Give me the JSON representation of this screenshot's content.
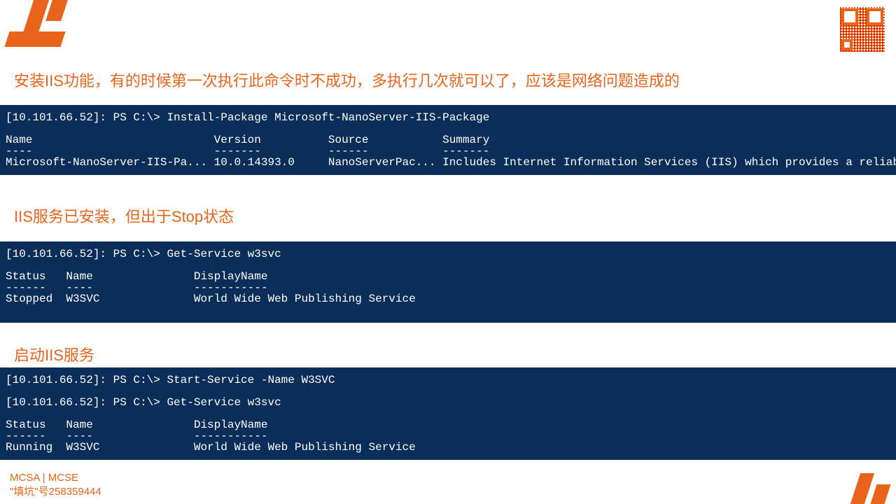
{
  "headings": {
    "h1": "安装IIS功能，有的时候第一次执行此命令时不成功，多执行几次就可以了，应该是网络问题造成的",
    "h2": "IIS服务已安装，但出于Stop状态",
    "h3": "启动IIS服务"
  },
  "terminal1": "[10.101.66.52]: PS C:\\> Install-Package Microsoft-NanoServer-IIS-Package\n\nName                           Version          Source           Summary\n----                           -------          ------           -------\nMicrosoft-NanoServer-IIS-Pa... 10.0.14393.0     NanoServerPac... Includes Internet Information Services (IIS) which provides a reliab...",
  "terminal2": "[10.101.66.52]: PS C:\\> Get-Service w3svc\n\nStatus   Name               DisplayName\n------   ----               -----------\nStopped  W3SVC              World Wide Web Publishing Service\n\n",
  "terminal3": "[10.101.66.52]: PS C:\\> Start-Service -Name W3SVC\n\n[10.101.66.52]: PS C:\\> Get-Service w3svc\n\nStatus   Name               DisplayName\n------   ----               -----------\nRunning  W3SVC              World Wide Web Publishing Service",
  "footer": {
    "line1": "MCSA | MCSE",
    "line2": "\"填坑\"号258359444"
  }
}
